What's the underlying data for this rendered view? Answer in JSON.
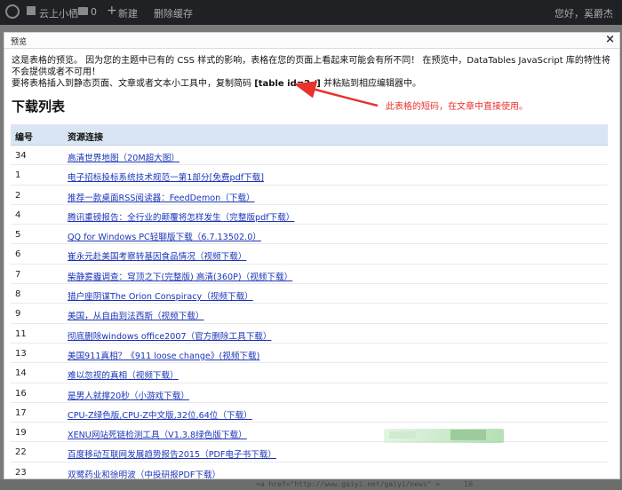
{
  "adminbar": {
    "site_name": "云上小栖",
    "comments": "0",
    "plus": "+",
    "new_label": "新建",
    "cache_label": "删除缓存",
    "greeting": "您好，奚爵杰"
  },
  "background": {
    "code_fragment": "<a href=\"http://www.gaiyi.net/gaiyi/news\" >",
    "number_fragment": "16"
  },
  "modal": {
    "title": "预览",
    "close_label": "×",
    "intro_line1": "这是表格的预览。 因为您的主题中已有的 CSS 样式的影响，表格在您的页面上看起来可能会有所不同！ 在预览中，DataTables JavaScript 库的特性将不会提供或者不可用！",
    "intro_line2_prefix": "要将表格插入到静态页面、文章或者文本小工具中，复制简码 ",
    "shortcode": "[table id=2 /]",
    "intro_line2_suffix": " 并粘贴到相应编辑器中。",
    "table_title": "下载列表",
    "annotation": "此表格的短码，在文章中直接使用。"
  },
  "table": {
    "headers": [
      "编号",
      "资源连接"
    ],
    "rows": [
      {
        "id": "34",
        "link": "高清世界地图（20M超大图）"
      },
      {
        "id": "1",
        "link": "电子招标投标系统技术规范一第1部分[免费pdf下载]"
      },
      {
        "id": "2",
        "link": "推荐一款桌面RSS阅读器：FeedDemon（下载）"
      },
      {
        "id": "4",
        "link": "腾讯重磅报告：全行业的颠覆将怎样发生（完整版pdf下载）"
      },
      {
        "id": "5",
        "link": "QQ for Windows PC轻聊版下载（6.7.13502.0）"
      },
      {
        "id": "6",
        "link": "崔永元赴美国考察转基因食品情况（视频下载）"
      },
      {
        "id": "7",
        "link": "柴静雾霾调查：穹顶之下(完整版) 高清(360P)（视频下载）"
      },
      {
        "id": "8",
        "link": "猎户座阴谋The Orion Conspiracy（视频下载）"
      },
      {
        "id": "9",
        "link": "美国，从自由到法西斯（视频下载）"
      },
      {
        "id": "11",
        "link": "彻底删除windows office2007（官方删除工具下载）"
      },
      {
        "id": "13",
        "link": "美国911真相？《911 loose change》(视频下载)"
      },
      {
        "id": "14",
        "link": "难以忽视的真相（视频下载）"
      },
      {
        "id": "16",
        "link": "是男人就撑20秒（小游戏下载）"
      },
      {
        "id": "17",
        "link": "CPU-Z绿色版,CPU-Z中文版,32位,64位（下载）"
      },
      {
        "id": "19",
        "link": "XENU网站死链检测工具（V1.3.8绿色版下载）"
      },
      {
        "id": "22",
        "link": "百度移动互联网发展趋势报告2015（PDF电子书下载）"
      },
      {
        "id": "23",
        "link": "双鹭药业和徐明波（中投研报PDF下载）"
      }
    ]
  },
  "colors": {
    "header_bg": "#d9e5f2",
    "link": "#1b35b8",
    "annotation": "#e8322d"
  }
}
